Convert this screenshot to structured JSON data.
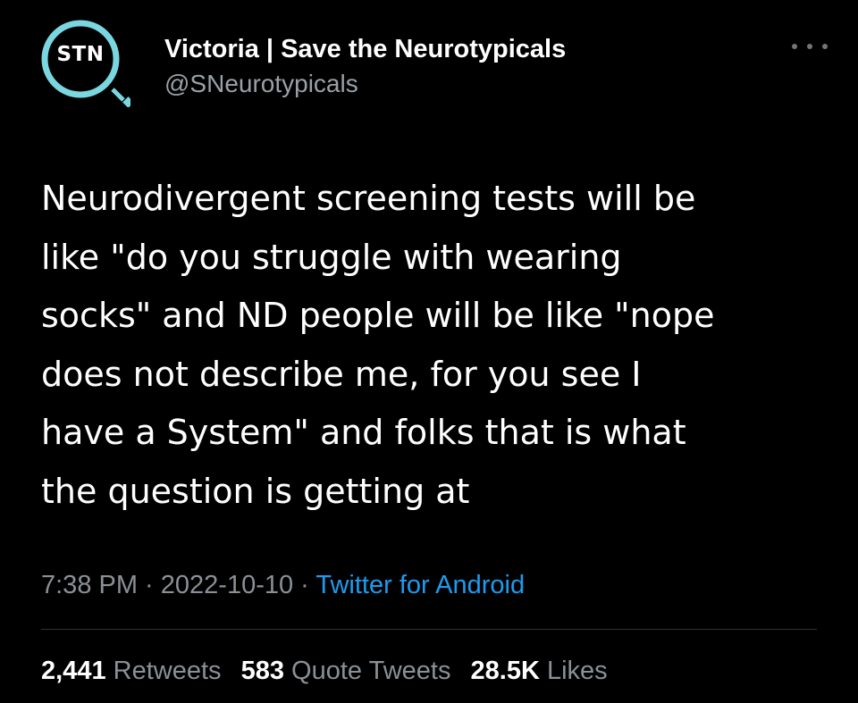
{
  "tweet": {
    "avatar": {
      "text": "STN",
      "ring_color": "#7ad7df"
    },
    "author": {
      "display_name": "Victoria | Save the Neurotypicals",
      "handle": "@SNeurotypicals"
    },
    "more_icon": "ellipsis-icon",
    "text_lines": [
      "Neurodivergent screening tests will be",
      "like \"do you struggle with wearing",
      "socks\" and ND people will be like \"nope",
      "does not describe me, for you see I",
      "have a System\" and folks that is what",
      "the question is getting at"
    ],
    "meta": {
      "time": "7:38 PM",
      "separator": " · ",
      "date": "2022-10-10",
      "source": "Twitter for Android"
    },
    "stats": {
      "retweets_count": "2,441",
      "retweets_label": "Retweets",
      "quotes_count": "583",
      "quotes_label": "Quote Tweets",
      "likes_count": "28.5K",
      "likes_label": "Likes"
    },
    "colors": {
      "background": "#000000",
      "text": "#ffffff",
      "secondary": "#8b9096",
      "link": "#1d9bf0"
    }
  }
}
